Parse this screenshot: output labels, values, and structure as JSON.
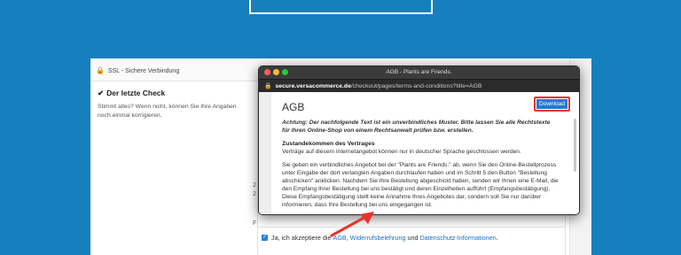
{
  "page": {
    "ssl_label": "SSL - Sichere Verbindung",
    "check_title": "Der letzte Check",
    "check_text": "Stimmt alles? Wenn nicht, können Sie Ihre Angaben noch einmal korrigieren.",
    "agree_prefix": "Ja, ich akzeptiere die",
    "agree_link_agb": "AGB",
    "agree_sep": ",",
    "agree_link_widerruf": "Widerrufsbelehrung",
    "agree_and": "und",
    "agree_link_datenschutz": "Datenschutz-Informationen",
    "agree_suffix": ".",
    "stub_char_1": "2",
    "stub_char_2": "2",
    "stub_char_3": "F"
  },
  "popup": {
    "window_title": "AGB - Plants are Friends.",
    "url_domain": "secure.versacommerce.de",
    "url_path": "/checkout/pages/terms-and-conditions?title=AGB",
    "heading": "AGB",
    "download_label": "Download",
    "notice": "Achtung: Der nachfolgende Text ist ein unverbindliches Muster. Bitte lassen Sie alle Rechtstexte für Ihren Online-Shop von einem Rechtsanwalt prüfen bzw. erstellen.",
    "section_title": "Zustandekommen des Vertrages",
    "para1": "Verträge auf diesem Internetangebot können nur in deutscher Sprache geschlossen werden.",
    "para2": "Sie geben ein verbindliches Angebot bei der \"Plants are Friends.\" ab, wenn Sie den Online-Bestellprozess unter Eingabe der dort verlangten Angaben durchlaufen haben und im Schritt 5 den Button \"Bestellung abschicken\" anklicken. Nachdem Sie Ihre Bestellung abgeschickt haben, senden wir Ihnen eine E-Mail, die den Empfang Ihrer Bestellung bei uns bestätigt und deren Einzelheiten aufführt (Empfangsbestätigung). Diese Empfangsbestätigung stellt keine Annahme Ihres Angebotes dar, sondern soll Sie nur darüber informieren, dass Ihre Bestellung bei uns eingegangen ist."
  },
  "colors": {
    "background": "#1580bd",
    "download_button": "#2778d2",
    "highlight": "#e7332b",
    "link": "#1a6fc9"
  },
  "icons": {
    "ssl": "lock-icon",
    "check": "checkmark-icon",
    "annotation": "red-arrow-icon"
  }
}
